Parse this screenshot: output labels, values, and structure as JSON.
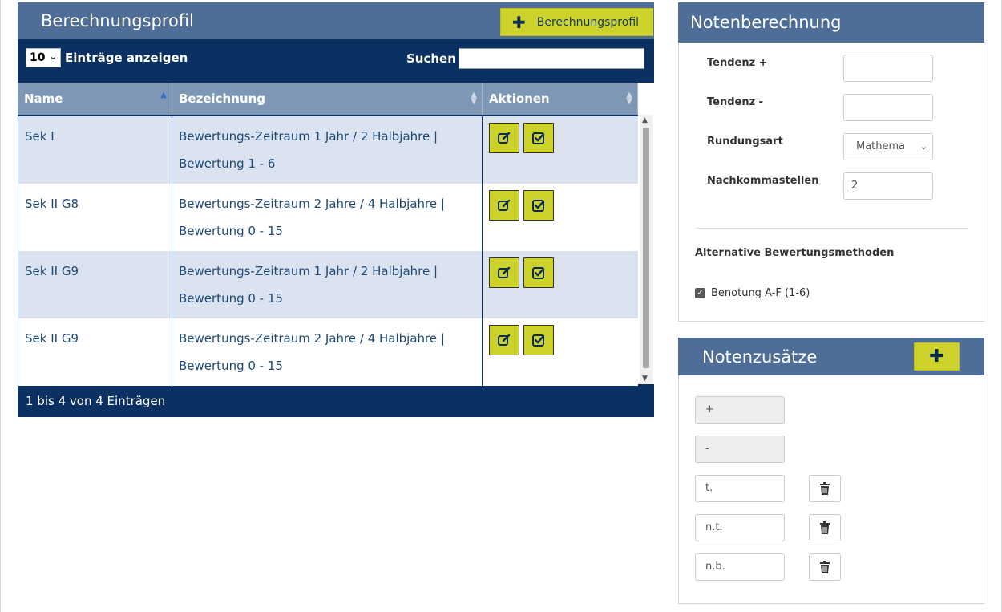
{
  "left": {
    "title": "Berechnungsprofil",
    "add_button_label": "Berechnungsprofil",
    "length_value": "10",
    "length_label": "Einträge anzeigen",
    "search_label": "Suchen",
    "search_value": "",
    "columns": [
      "Name",
      "Bezeichnung",
      "Aktionen"
    ],
    "rows": [
      {
        "name": "Sek I",
        "line1": "Bewertungs-Zeitraum 1 Jahr / 2 Halbjahre |",
        "line2": "Bewertung 1 - 6"
      },
      {
        "name": "Sek II G8",
        "line1": "Bewertungs-Zeitraum 2 Jahre / 4 Halbjahre |",
        "line2": "Bewertung 0 - 15"
      },
      {
        "name": "Sek II G9",
        "line1": "Bewertungs-Zeitraum 1 Jahr / 2 Halbjahre |",
        "line2": "Bewertung 0 - 15"
      },
      {
        "name": "Sek II G9",
        "line1": "Bewertungs-Zeitraum 2 Jahre / 4 Halbjahre |",
        "line2": "Bewertung 0 - 15"
      }
    ],
    "info": "1 bis 4 von 4 Einträgen"
  },
  "notenberechnung": {
    "title": "Notenberechnung",
    "tendenz_plus_label": "Tendenz +",
    "tendenz_plus_value": "",
    "tendenz_minus_label": "Tendenz -",
    "tendenz_minus_value": "",
    "rundungsart_label": "Rundungsart",
    "rundungsart_value": "Mathema",
    "nachkommastellen_label": "Nachkommastellen",
    "nachkommastellen_value": "2",
    "alt_title": "Alternative Bewertungsmethoden",
    "alt_option": "Benotung A-F (1-6)"
  },
  "notenzusaetze": {
    "title": "Notenzusätze",
    "items": [
      "+",
      "-",
      "t.",
      "n.t.",
      "n.b."
    ]
  },
  "colors": {
    "header_blue": "#4e6e98",
    "dark_blue": "#0b3162",
    "accent_yellow": "#cdd22a"
  }
}
